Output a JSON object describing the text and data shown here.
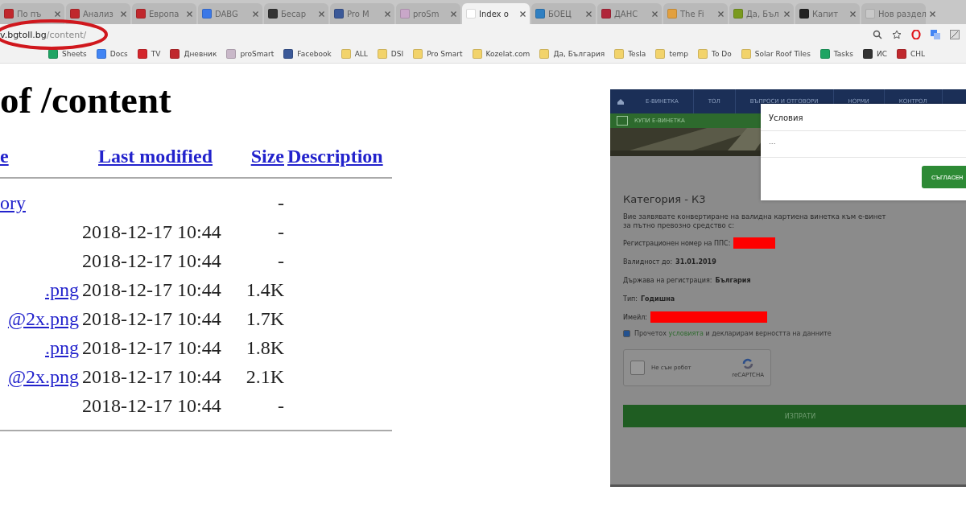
{
  "browser": {
    "tabs": [
      {
        "label": "По пъ",
        "selected": false,
        "color": "#c0282d"
      },
      {
        "label": "Анализ",
        "selected": false,
        "color": "#c0282d"
      },
      {
        "label": "Европа",
        "selected": false,
        "color": "#c0282d"
      },
      {
        "label": "DABG",
        "selected": false,
        "color": "#3b78e7"
      },
      {
        "label": "Бесар",
        "selected": false,
        "color": "#333333"
      },
      {
        "label": "Pro M",
        "selected": false,
        "color": "#3b5998"
      },
      {
        "label": "proSm",
        "selected": false,
        "color": "#c9a7c9"
      },
      {
        "label": "Index o",
        "selected": true,
        "color": "#ffffff"
      },
      {
        "label": "БОЕЦ",
        "selected": false,
        "color": "#2f7fc1"
      },
      {
        "label": "ДАНС",
        "selected": false,
        "color": "#b0263a"
      },
      {
        "label": "The Fi",
        "selected": false,
        "color": "#e2a03f"
      },
      {
        "label": "Да, Бъл",
        "selected": false,
        "color": "#7a9a1f"
      },
      {
        "label": "Капит",
        "selected": false,
        "color": "#222222"
      },
      {
        "label": "Нов раздел",
        "selected": false,
        "color": "#c8c8c8"
      }
    ],
    "address": {
      "domain": "v.bgtoll.bg",
      "path": "/content/"
    },
    "bookmarks": [
      {
        "label": "Sheets",
        "color": "#1fa463"
      },
      {
        "label": "Docs",
        "color": "#4285f4"
      },
      {
        "label": "TV",
        "color": "#d4262c"
      },
      {
        "label": "Дневник",
        "color": "#c0282d"
      },
      {
        "label": "proSmart",
        "color": "#c9b8c9"
      },
      {
        "label": "Facebook",
        "color": "#3b5998"
      },
      {
        "label": "ALL",
        "color": "#f2d36b"
      },
      {
        "label": "DSI",
        "color": "#f2d36b"
      },
      {
        "label": "Pro Smart",
        "color": "#f2d36b"
      },
      {
        "label": "Kozelat.com",
        "color": "#f2d36b"
      },
      {
        "label": "Да, България",
        "color": "#f2d36b"
      },
      {
        "label": "Tesla",
        "color": "#f2d36b"
      },
      {
        "label": "temp",
        "color": "#f2d36b"
      },
      {
        "label": "To Do",
        "color": "#f2d36b"
      },
      {
        "label": "Solar Roof Tiles",
        "color": "#f2d36b"
      },
      {
        "label": "Tasks",
        "color": "#1fa463"
      },
      {
        "label": "ИС",
        "color": "#333333"
      },
      {
        "label": "CHL",
        "color": "#c0282d"
      }
    ]
  },
  "listing": {
    "title": "of /content",
    "columns": [
      "e",
      "Last modified",
      "Size",
      "Description"
    ],
    "rows": [
      {
        "name": "ory",
        "modified": "",
        "size": "-"
      },
      {
        "name": "",
        "modified": "2018-12-17 10:44",
        "size": "-"
      },
      {
        "name": "",
        "modified": "2018-12-17 10:44",
        "size": "-"
      },
      {
        "name": ".png",
        "modified": "2018-12-17 10:44",
        "size": "1.4K"
      },
      {
        "name": "@2x.png",
        "modified": "2018-12-17 10:44",
        "size": "1.7K"
      },
      {
        "name": ".png",
        "modified": "2018-12-17 10:44",
        "size": "1.8K"
      },
      {
        "name": "@2x.png",
        "modified": "2018-12-17 10:44",
        "size": "2.1K"
      },
      {
        "name": "",
        "modified": "2018-12-17 10:44",
        "size": "-"
      }
    ]
  },
  "inset": {
    "nav": [
      "Е-ВИНЕТКА",
      "ТОЛ",
      "ВЪПРОСИ И ОТГОВОРИ",
      "НОРМИ",
      "КОНТРОЛ"
    ],
    "buy_label": "КУПИ Е-ВИНЕТКА",
    "modal": {
      "title": "Условия",
      "body": "...",
      "button": "СЪГЛАСЕН"
    },
    "category": "Категория - К3",
    "intro": [
      "Вие заявявате конвертиране на валидна картиена винетка към е-винет",
      "за пътно превозно средство с:"
    ],
    "fields": [
      {
        "label": "Регистрационен номер на ППС:",
        "redacted": true
      },
      {
        "label": "Валидност до:",
        "value": "31.01.2019",
        "redacted": false
      },
      {
        "label": "Държава на регистрация:",
        "value": "България",
        "redacted": false
      },
      {
        "label": "Тип:",
        "value": "Годишна",
        "redacted": false
      },
      {
        "label": "Имейл:",
        "redacted": true
      }
    ],
    "consent": {
      "checked": true,
      "before": "Прочетох",
      "link": "условията",
      "after": "и декларирам верността на данните"
    },
    "captcha": {
      "label": "Не съм робот",
      "brand": "reCAPTCHA",
      "checked": false
    },
    "submit": "ИЗПРАТИ"
  }
}
